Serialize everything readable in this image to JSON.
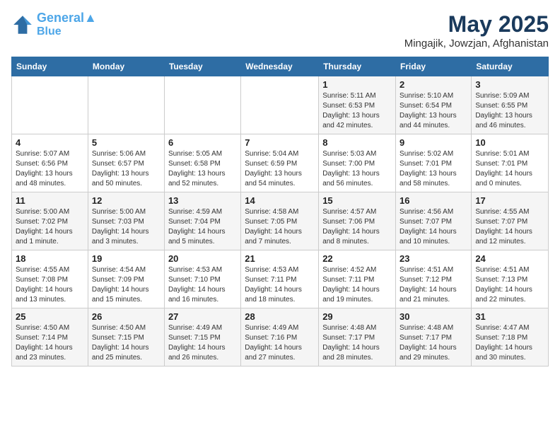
{
  "header": {
    "logo_line1": "General",
    "logo_line2": "Blue",
    "month": "May 2025",
    "location": "Mingajik, Jowzjan, Afghanistan"
  },
  "days_of_week": [
    "Sunday",
    "Monday",
    "Tuesday",
    "Wednesday",
    "Thursday",
    "Friday",
    "Saturday"
  ],
  "weeks": [
    [
      {
        "day": "",
        "info": ""
      },
      {
        "day": "",
        "info": ""
      },
      {
        "day": "",
        "info": ""
      },
      {
        "day": "",
        "info": ""
      },
      {
        "day": "1",
        "info": "Sunrise: 5:11 AM\nSunset: 6:53 PM\nDaylight: 13 hours\nand 42 minutes."
      },
      {
        "day": "2",
        "info": "Sunrise: 5:10 AM\nSunset: 6:54 PM\nDaylight: 13 hours\nand 44 minutes."
      },
      {
        "day": "3",
        "info": "Sunrise: 5:09 AM\nSunset: 6:55 PM\nDaylight: 13 hours\nand 46 minutes."
      }
    ],
    [
      {
        "day": "4",
        "info": "Sunrise: 5:07 AM\nSunset: 6:56 PM\nDaylight: 13 hours\nand 48 minutes."
      },
      {
        "day": "5",
        "info": "Sunrise: 5:06 AM\nSunset: 6:57 PM\nDaylight: 13 hours\nand 50 minutes."
      },
      {
        "day": "6",
        "info": "Sunrise: 5:05 AM\nSunset: 6:58 PM\nDaylight: 13 hours\nand 52 minutes."
      },
      {
        "day": "7",
        "info": "Sunrise: 5:04 AM\nSunset: 6:59 PM\nDaylight: 13 hours\nand 54 minutes."
      },
      {
        "day": "8",
        "info": "Sunrise: 5:03 AM\nSunset: 7:00 PM\nDaylight: 13 hours\nand 56 minutes."
      },
      {
        "day": "9",
        "info": "Sunrise: 5:02 AM\nSunset: 7:01 PM\nDaylight: 13 hours\nand 58 minutes."
      },
      {
        "day": "10",
        "info": "Sunrise: 5:01 AM\nSunset: 7:01 PM\nDaylight: 14 hours\nand 0 minutes."
      }
    ],
    [
      {
        "day": "11",
        "info": "Sunrise: 5:00 AM\nSunset: 7:02 PM\nDaylight: 14 hours\nand 1 minute."
      },
      {
        "day": "12",
        "info": "Sunrise: 5:00 AM\nSunset: 7:03 PM\nDaylight: 14 hours\nand 3 minutes."
      },
      {
        "day": "13",
        "info": "Sunrise: 4:59 AM\nSunset: 7:04 PM\nDaylight: 14 hours\nand 5 minutes."
      },
      {
        "day": "14",
        "info": "Sunrise: 4:58 AM\nSunset: 7:05 PM\nDaylight: 14 hours\nand 7 minutes."
      },
      {
        "day": "15",
        "info": "Sunrise: 4:57 AM\nSunset: 7:06 PM\nDaylight: 14 hours\nand 8 minutes."
      },
      {
        "day": "16",
        "info": "Sunrise: 4:56 AM\nSunset: 7:07 PM\nDaylight: 14 hours\nand 10 minutes."
      },
      {
        "day": "17",
        "info": "Sunrise: 4:55 AM\nSunset: 7:07 PM\nDaylight: 14 hours\nand 12 minutes."
      }
    ],
    [
      {
        "day": "18",
        "info": "Sunrise: 4:55 AM\nSunset: 7:08 PM\nDaylight: 14 hours\nand 13 minutes."
      },
      {
        "day": "19",
        "info": "Sunrise: 4:54 AM\nSunset: 7:09 PM\nDaylight: 14 hours\nand 15 minutes."
      },
      {
        "day": "20",
        "info": "Sunrise: 4:53 AM\nSunset: 7:10 PM\nDaylight: 14 hours\nand 16 minutes."
      },
      {
        "day": "21",
        "info": "Sunrise: 4:53 AM\nSunset: 7:11 PM\nDaylight: 14 hours\nand 18 minutes."
      },
      {
        "day": "22",
        "info": "Sunrise: 4:52 AM\nSunset: 7:11 PM\nDaylight: 14 hours\nand 19 minutes."
      },
      {
        "day": "23",
        "info": "Sunrise: 4:51 AM\nSunset: 7:12 PM\nDaylight: 14 hours\nand 21 minutes."
      },
      {
        "day": "24",
        "info": "Sunrise: 4:51 AM\nSunset: 7:13 PM\nDaylight: 14 hours\nand 22 minutes."
      }
    ],
    [
      {
        "day": "25",
        "info": "Sunrise: 4:50 AM\nSunset: 7:14 PM\nDaylight: 14 hours\nand 23 minutes."
      },
      {
        "day": "26",
        "info": "Sunrise: 4:50 AM\nSunset: 7:15 PM\nDaylight: 14 hours\nand 25 minutes."
      },
      {
        "day": "27",
        "info": "Sunrise: 4:49 AM\nSunset: 7:15 PM\nDaylight: 14 hours\nand 26 minutes."
      },
      {
        "day": "28",
        "info": "Sunrise: 4:49 AM\nSunset: 7:16 PM\nDaylight: 14 hours\nand 27 minutes."
      },
      {
        "day": "29",
        "info": "Sunrise: 4:48 AM\nSunset: 7:17 PM\nDaylight: 14 hours\nand 28 minutes."
      },
      {
        "day": "30",
        "info": "Sunrise: 4:48 AM\nSunset: 7:17 PM\nDaylight: 14 hours\nand 29 minutes."
      },
      {
        "day": "31",
        "info": "Sunrise: 4:47 AM\nSunset: 7:18 PM\nDaylight: 14 hours\nand 30 minutes."
      }
    ]
  ]
}
